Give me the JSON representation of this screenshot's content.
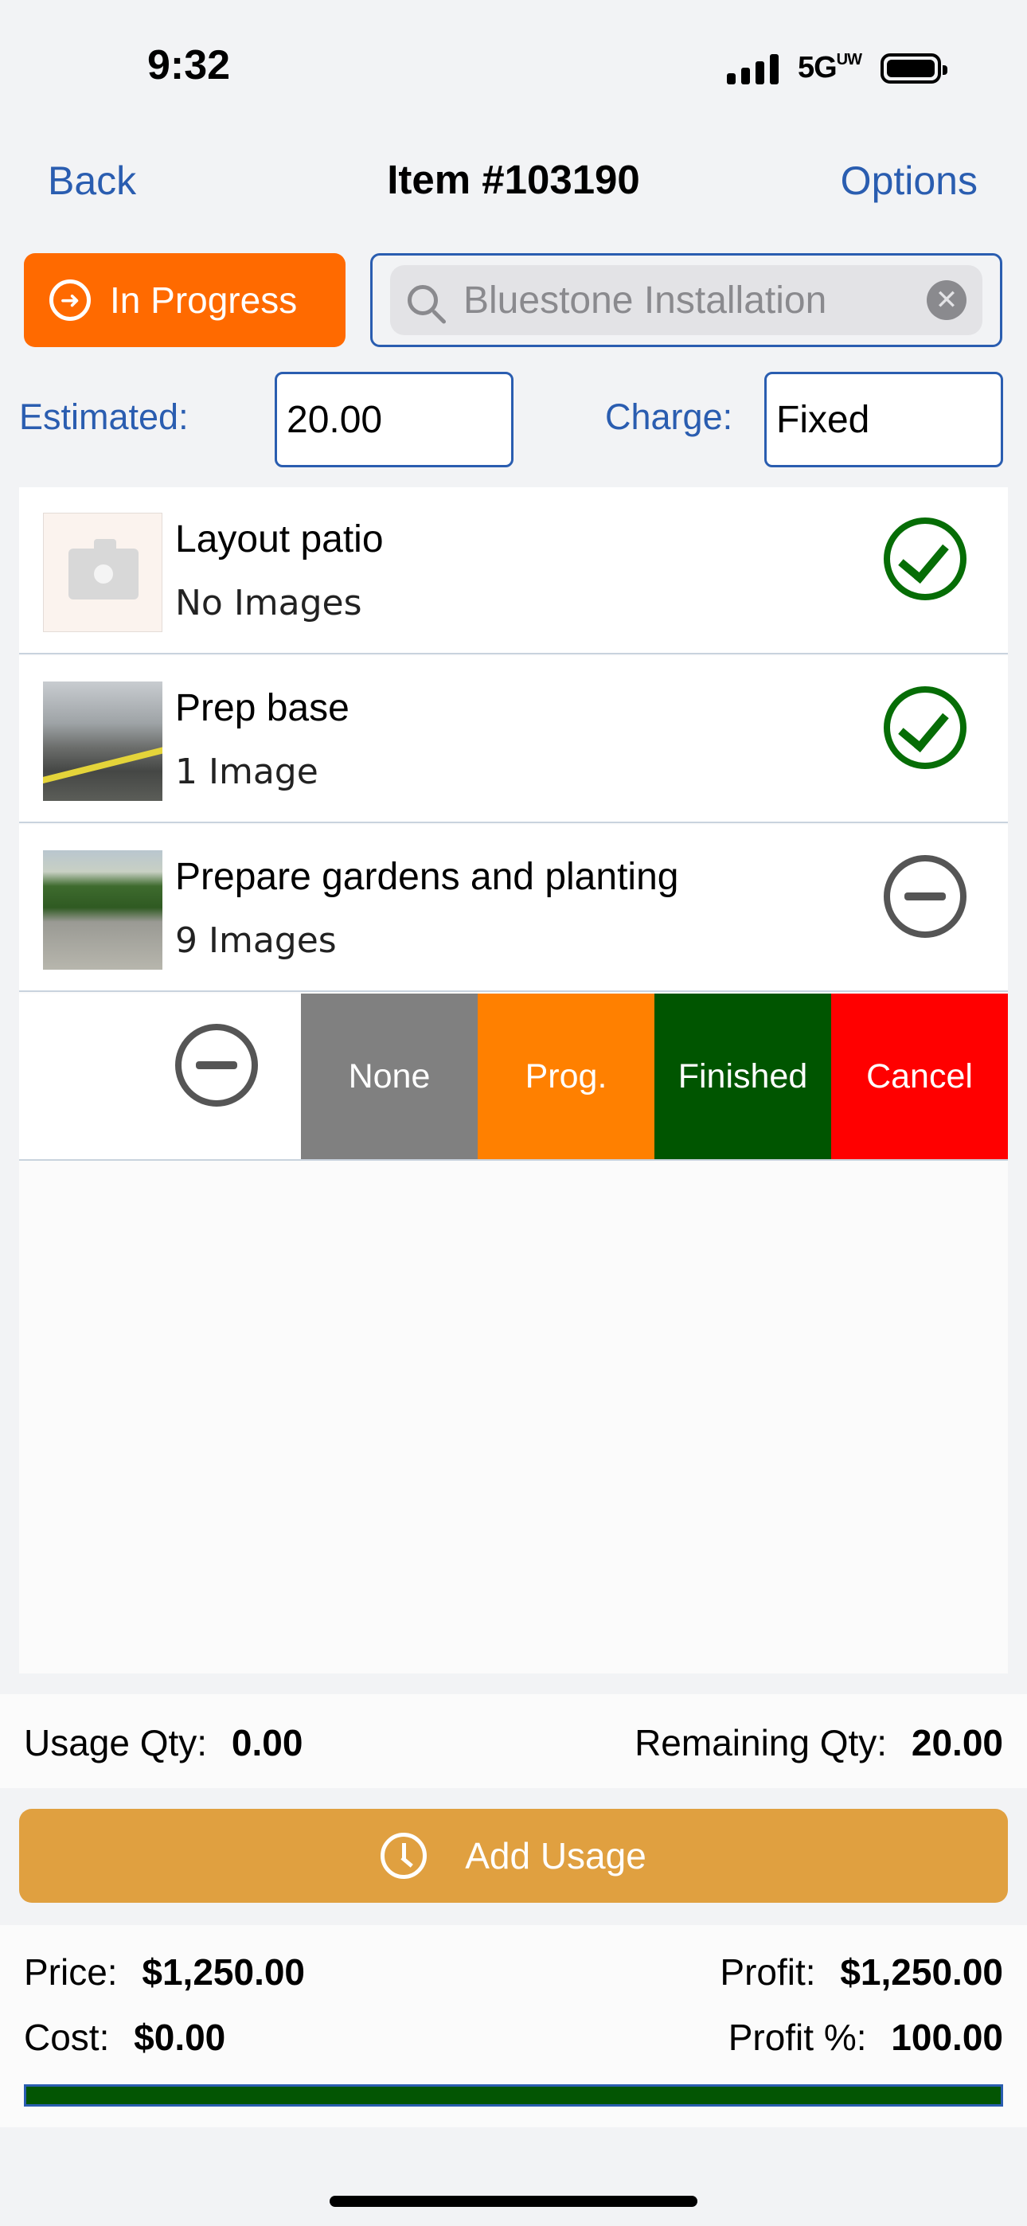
{
  "status_bar": {
    "time": "9:32",
    "network": "5G",
    "network_sup": "UW"
  },
  "nav": {
    "back": "Back",
    "title": "Item #103190",
    "options": "Options"
  },
  "status_button": {
    "label": "In Progress",
    "color": "#ff6a00"
  },
  "search": {
    "placeholder": "Bluestone Installation"
  },
  "estimated": {
    "label": "Estimated:",
    "value": "20.00"
  },
  "charge": {
    "label": "Charge:",
    "value": "Fixed"
  },
  "tasks": [
    {
      "title": "Layout patio",
      "subtitle": "No Images",
      "status": "finished"
    },
    {
      "title": "Prep base",
      "subtitle": "1 Image",
      "status": "finished"
    },
    {
      "title": "Prepare gardens and planting",
      "subtitle": "9 Images",
      "status": "none"
    }
  ],
  "swipe_actions": {
    "none": {
      "label": "None",
      "color": "#808080"
    },
    "progress": {
      "label": "Prog.",
      "color": "#ff8000"
    },
    "finished": {
      "label": "Finished",
      "color": "#005500"
    },
    "cancel": {
      "label": "Cancel",
      "color": "#ff0000"
    }
  },
  "usage": {
    "usage_label": "Usage Qty:",
    "usage_value": "0.00",
    "remaining_label": "Remaining Qty:",
    "remaining_value": "20.00"
  },
  "add_usage": {
    "label": "Add Usage",
    "color": "#e0a040"
  },
  "summary": {
    "price_label": "Price:",
    "price_value": "$1,250.00",
    "cost_label": "Cost:",
    "cost_value": "$0.00",
    "profit_label": "Profit:",
    "profit_value": "$1,250.00",
    "profit_pct_label": "Profit %:",
    "profit_pct_value": "100.00",
    "profit_fraction": 1.0
  }
}
